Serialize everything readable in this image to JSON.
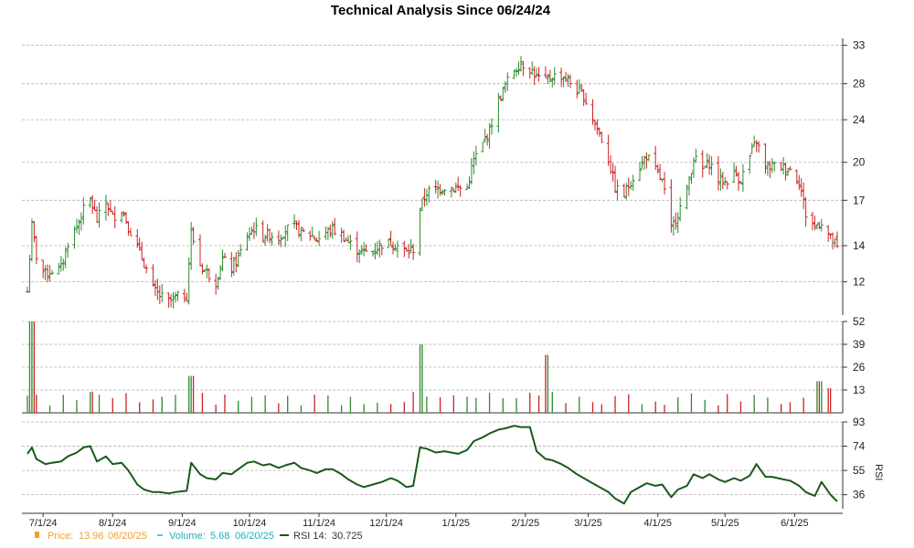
{
  "chart_data": [
    {
      "panel": "price",
      "type": "ohlc",
      "title": "Technical Analysis Since 06/24/24",
      "y_scale": "log",
      "ylim": [
        10.4,
        34.0
      ],
      "y_ticks": [
        12,
        14,
        17,
        20,
        24,
        28,
        33
      ],
      "x_range": [
        "2024-06-24",
        "2025-06-20"
      ],
      "x_ticks": [
        {
          "date": "2024-07-01",
          "label": "7/1/24"
        },
        {
          "date": "2024-08-01",
          "label": "8/1/24"
        },
        {
          "date": "2024-09-01",
          "label": "9/1/24"
        },
        {
          "date": "2024-10-01",
          "label": "10/1/24"
        },
        {
          "date": "2024-11-01",
          "label": "11/1/24"
        },
        {
          "date": "2024-12-01",
          "label": "12/1/24"
        },
        {
          "date": "2025-01-01",
          "label": "1/1/25"
        },
        {
          "date": "2025-02-01",
          "label": "2/1/25"
        },
        {
          "date": "2025-03-01",
          "label": "3/1/25"
        },
        {
          "date": "2025-04-01",
          "label": "4/1/25"
        },
        {
          "date": "2025-05-01",
          "label": "5/1/25"
        },
        {
          "date": "2025-06-01",
          "label": "6/1/25"
        }
      ],
      "grid": true,
      "close_series": [
        [
          "2024-06-24",
          11.5
        ],
        [
          "2024-06-26",
          15.2
        ],
        [
          "2024-06-28",
          13.4
        ],
        [
          "2024-07-02",
          12.4
        ],
        [
          "2024-07-05",
          12.6
        ],
        [
          "2024-07-09",
          12.7
        ],
        [
          "2024-07-12",
          14.2
        ],
        [
          "2024-07-16",
          15.2
        ],
        [
          "2024-07-19",
          16.3
        ],
        [
          "2024-07-22",
          17.1
        ],
        [
          "2024-07-25",
          15.6
        ],
        [
          "2024-07-29",
          16.9
        ],
        [
          "2024-08-01",
          15.8
        ],
        [
          "2024-08-05",
          16.4
        ],
        [
          "2024-08-08",
          15.2
        ],
        [
          "2024-08-12",
          13.9
        ],
        [
          "2024-08-15",
          13.0
        ],
        [
          "2024-08-19",
          11.6
        ],
        [
          "2024-08-22",
          11.3
        ],
        [
          "2024-08-26",
          11.0
        ],
        [
          "2024-08-29",
          11.2
        ],
        [
          "2024-09-03",
          11.3
        ],
        [
          "2024-09-05",
          14.8
        ],
        [
          "2024-09-09",
          12.9
        ],
        [
          "2024-09-12",
          12.5
        ],
        [
          "2024-09-16",
          12.0
        ],
        [
          "2024-09-19",
          13.2
        ],
        [
          "2024-09-23",
          12.7
        ],
        [
          "2024-09-26",
          13.3
        ],
        [
          "2024-09-30",
          14.6
        ],
        [
          "2024-10-03",
          15.1
        ],
        [
          "2024-10-07",
          14.6
        ],
        [
          "2024-10-10",
          14.7
        ],
        [
          "2024-10-14",
          14.5
        ],
        [
          "2024-10-17",
          15.0
        ],
        [
          "2024-10-21",
          15.2
        ],
        [
          "2024-10-24",
          14.8
        ],
        [
          "2024-10-28",
          14.7
        ],
        [
          "2024-10-31",
          14.4
        ],
        [
          "2024-11-04",
          14.8
        ],
        [
          "2024-11-07",
          15.0
        ],
        [
          "2024-11-11",
          14.7
        ],
        [
          "2024-11-14",
          14.2
        ],
        [
          "2024-11-18",
          13.8
        ],
        [
          "2024-11-21",
          13.6
        ],
        [
          "2024-11-25",
          13.7
        ],
        [
          "2024-11-29",
          14.1
        ],
        [
          "2024-12-03",
          14.2
        ],
        [
          "2024-12-06",
          14.0
        ],
        [
          "2024-12-10",
          13.6
        ],
        [
          "2024-12-13",
          13.8
        ],
        [
          "2024-12-16",
          16.4
        ],
        [
          "2024-12-19",
          17.6
        ],
        [
          "2024-12-23",
          17.8
        ],
        [
          "2024-12-27",
          18.0
        ],
        [
          "2025-01-02",
          17.9
        ],
        [
          "2025-01-06",
          17.9
        ],
        [
          "2025-01-09",
          20.2
        ],
        [
          "2025-01-13",
          21.6
        ],
        [
          "2025-01-16",
          23.0
        ],
        [
          "2025-01-20",
          26.0
        ],
        [
          "2025-01-23",
          27.8
        ],
        [
          "2025-01-27",
          29.8
        ],
        [
          "2025-01-30",
          30.6
        ],
        [
          "2025-02-03",
          29.9
        ],
        [
          "2025-02-06",
          28.8
        ],
        [
          "2025-02-10",
          28.3
        ],
        [
          "2025-02-13",
          28.9
        ],
        [
          "2025-02-17",
          29.0
        ],
        [
          "2025-02-20",
          28.4
        ],
        [
          "2025-02-24",
          27.2
        ],
        [
          "2025-02-27",
          26.5
        ],
        [
          "2025-03-03",
          24.2
        ],
        [
          "2025-03-06",
          22.6
        ],
        [
          "2025-03-10",
          20.3
        ],
        [
          "2025-03-13",
          17.9
        ],
        [
          "2025-03-17",
          17.4
        ],
        [
          "2025-03-20",
          18.5
        ],
        [
          "2025-03-24",
          19.6
        ],
        [
          "2025-03-27",
          20.6
        ],
        [
          "2025-03-31",
          19.3
        ],
        [
          "2025-04-03",
          18.4
        ],
        [
          "2025-04-07",
          15.0
        ],
        [
          "2025-04-10",
          16.1
        ],
        [
          "2025-04-14",
          17.7
        ],
        [
          "2025-04-17",
          20.4
        ],
        [
          "2025-04-21",
          19.4
        ],
        [
          "2025-04-24",
          20.0
        ],
        [
          "2025-04-28",
          18.6
        ],
        [
          "2025-05-01",
          18.4
        ],
        [
          "2025-05-05",
          19.1
        ],
        [
          "2025-05-08",
          18.6
        ],
        [
          "2025-05-12",
          20.5
        ],
        [
          "2025-05-15",
          21.9
        ],
        [
          "2025-05-19",
          19.5
        ],
        [
          "2025-05-22",
          19.7
        ],
        [
          "2025-05-27",
          19.6
        ],
        [
          "2025-05-30",
          19.4
        ],
        [
          "2025-06-03",
          18.5
        ],
        [
          "2025-06-06",
          16.0
        ],
        [
          "2025-06-10",
          15.2
        ],
        [
          "2025-06-13",
          15.5
        ],
        [
          "2025-06-17",
          14.4
        ],
        [
          "2025-06-20",
          13.96
        ]
      ],
      "legend": {
        "label": "Price:",
        "value": "13.96",
        "date": "06/20/25",
        "color": "#f0a030"
      }
    },
    {
      "panel": "volume",
      "type": "bar",
      "ylim": [
        0,
        52
      ],
      "y_ticks": [
        13,
        26,
        39,
        52
      ],
      "spikes": [
        [
          "2024-06-26",
          52
        ],
        [
          "2024-07-22",
          12
        ],
        [
          "2024-09-05",
          21
        ],
        [
          "2024-12-16",
          39
        ],
        [
          "2025-02-10",
          33
        ],
        [
          "2025-06-12",
          18
        ],
        [
          "2025-06-16",
          14
        ]
      ],
      "legend": {
        "label": "Volume:",
        "value": "5.68",
        "date": "06/20/25",
        "color": "#20b0c0"
      }
    },
    {
      "panel": "rsi",
      "type": "line",
      "ylabel": "RSI",
      "ylim": [
        25,
        93
      ],
      "y_ticks": [
        36,
        55,
        74,
        93
      ],
      "series": [
        [
          "2024-06-24",
          68
        ],
        [
          "2024-06-26",
          73
        ],
        [
          "2024-06-28",
          64
        ],
        [
          "2024-07-02",
          60
        ],
        [
          "2024-07-05",
          61
        ],
        [
          "2024-07-09",
          62
        ],
        [
          "2024-07-12",
          66
        ],
        [
          "2024-07-16",
          69
        ],
        [
          "2024-07-19",
          73
        ],
        [
          "2024-07-22",
          74
        ],
        [
          "2024-07-25",
          62
        ],
        [
          "2024-07-29",
          66
        ],
        [
          "2024-08-01",
          60
        ],
        [
          "2024-08-05",
          61
        ],
        [
          "2024-08-08",
          55
        ],
        [
          "2024-08-12",
          44
        ],
        [
          "2024-08-15",
          40
        ],
        [
          "2024-08-19",
          38
        ],
        [
          "2024-08-22",
          38
        ],
        [
          "2024-08-26",
          37
        ],
        [
          "2024-08-29",
          38
        ],
        [
          "2024-09-03",
          39
        ],
        [
          "2024-09-05",
          61
        ],
        [
          "2024-09-09",
          52
        ],
        [
          "2024-09-12",
          49
        ],
        [
          "2024-09-16",
          48
        ],
        [
          "2024-09-19",
          53
        ],
        [
          "2024-09-23",
          52
        ],
        [
          "2024-09-26",
          56
        ],
        [
          "2024-09-30",
          61
        ],
        [
          "2024-10-03",
          62
        ],
        [
          "2024-10-07",
          59
        ],
        [
          "2024-10-10",
          60
        ],
        [
          "2024-10-14",
          57
        ],
        [
          "2024-10-17",
          59
        ],
        [
          "2024-10-21",
          61
        ],
        [
          "2024-10-24",
          57
        ],
        [
          "2024-10-28",
          55
        ],
        [
          "2024-10-31",
          53
        ],
        [
          "2024-11-04",
          56
        ],
        [
          "2024-11-07",
          56
        ],
        [
          "2024-11-11",
          52
        ],
        [
          "2024-11-14",
          48
        ],
        [
          "2024-11-18",
          44
        ],
        [
          "2024-11-21",
          42
        ],
        [
          "2024-11-25",
          44
        ],
        [
          "2024-11-29",
          46
        ],
        [
          "2024-12-03",
          49
        ],
        [
          "2024-12-06",
          47
        ],
        [
          "2024-12-10",
          42
        ],
        [
          "2024-12-13",
          43
        ],
        [
          "2024-12-16",
          73
        ],
        [
          "2024-12-19",
          72
        ],
        [
          "2024-12-23",
          69
        ],
        [
          "2024-12-27",
          70
        ],
        [
          "2025-01-02",
          68
        ],
        [
          "2025-01-06",
          71
        ],
        [
          "2025-01-09",
          78
        ],
        [
          "2025-01-13",
          81
        ],
        [
          "2025-01-16",
          84
        ],
        [
          "2025-01-20",
          87
        ],
        [
          "2025-01-23",
          88
        ],
        [
          "2025-01-27",
          90
        ],
        [
          "2025-01-30",
          89
        ],
        [
          "2025-02-03",
          89
        ],
        [
          "2025-02-06",
          70
        ],
        [
          "2025-02-10",
          64
        ],
        [
          "2025-02-13",
          63
        ],
        [
          "2025-02-17",
          60
        ],
        [
          "2025-02-20",
          57
        ],
        [
          "2025-02-24",
          52
        ],
        [
          "2025-02-27",
          49
        ],
        [
          "2025-03-03",
          45
        ],
        [
          "2025-03-06",
          42
        ],
        [
          "2025-03-10",
          38
        ],
        [
          "2025-03-13",
          33
        ],
        [
          "2025-03-17",
          29
        ],
        [
          "2025-03-20",
          38
        ],
        [
          "2025-03-24",
          42
        ],
        [
          "2025-03-27",
          45
        ],
        [
          "2025-03-31",
          43
        ],
        [
          "2025-04-03",
          44
        ],
        [
          "2025-04-07",
          34
        ],
        [
          "2025-04-10",
          40
        ],
        [
          "2025-04-14",
          43
        ],
        [
          "2025-04-17",
          52
        ],
        [
          "2025-04-21",
          49
        ],
        [
          "2025-04-24",
          52
        ],
        [
          "2025-04-28",
          48
        ],
        [
          "2025-05-01",
          46
        ],
        [
          "2025-05-05",
          49
        ],
        [
          "2025-05-08",
          47
        ],
        [
          "2025-05-12",
          51
        ],
        [
          "2025-05-15",
          60
        ],
        [
          "2025-05-19",
          50
        ],
        [
          "2025-05-22",
          50
        ],
        [
          "2025-05-27",
          48
        ],
        [
          "2025-05-30",
          47
        ],
        [
          "2025-06-03",
          43
        ],
        [
          "2025-06-06",
          38
        ],
        [
          "2025-06-10",
          35
        ],
        [
          "2025-06-13",
          46
        ],
        [
          "2025-06-17",
          36
        ],
        [
          "2025-06-20",
          30.725
        ]
      ],
      "legend": {
        "label": "RSI 14:",
        "value": "30.725",
        "color": "#1a5a1a"
      }
    }
  ],
  "colors": {
    "up": "#2e8b2e",
    "down": "#cc2222",
    "rsi": "#1a5a1a",
    "grid": "#b0b0b0",
    "axis": "#333333"
  }
}
